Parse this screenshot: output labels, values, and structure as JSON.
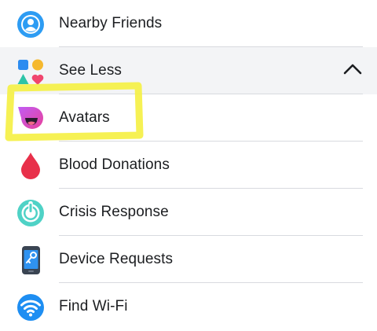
{
  "menu": {
    "items": [
      {
        "label": "Nearby Friends",
        "icon": "nearby-friends-icon"
      },
      {
        "label": "See Less",
        "icon": "shapes-icon"
      },
      {
        "label": "Avatars",
        "icon": "avatars-icon"
      },
      {
        "label": "Blood Donations",
        "icon": "blood-drop-icon"
      },
      {
        "label": "Crisis Response",
        "icon": "crisis-response-icon"
      },
      {
        "label": "Device Requests",
        "icon": "device-requests-icon"
      },
      {
        "label": "Find Wi-Fi",
        "icon": "wifi-icon"
      }
    ]
  },
  "colors": {
    "text": "#1c1e21",
    "divider": "#d8dadf",
    "section_background": "#f3f4f6",
    "highlighter": "#f5f045"
  }
}
